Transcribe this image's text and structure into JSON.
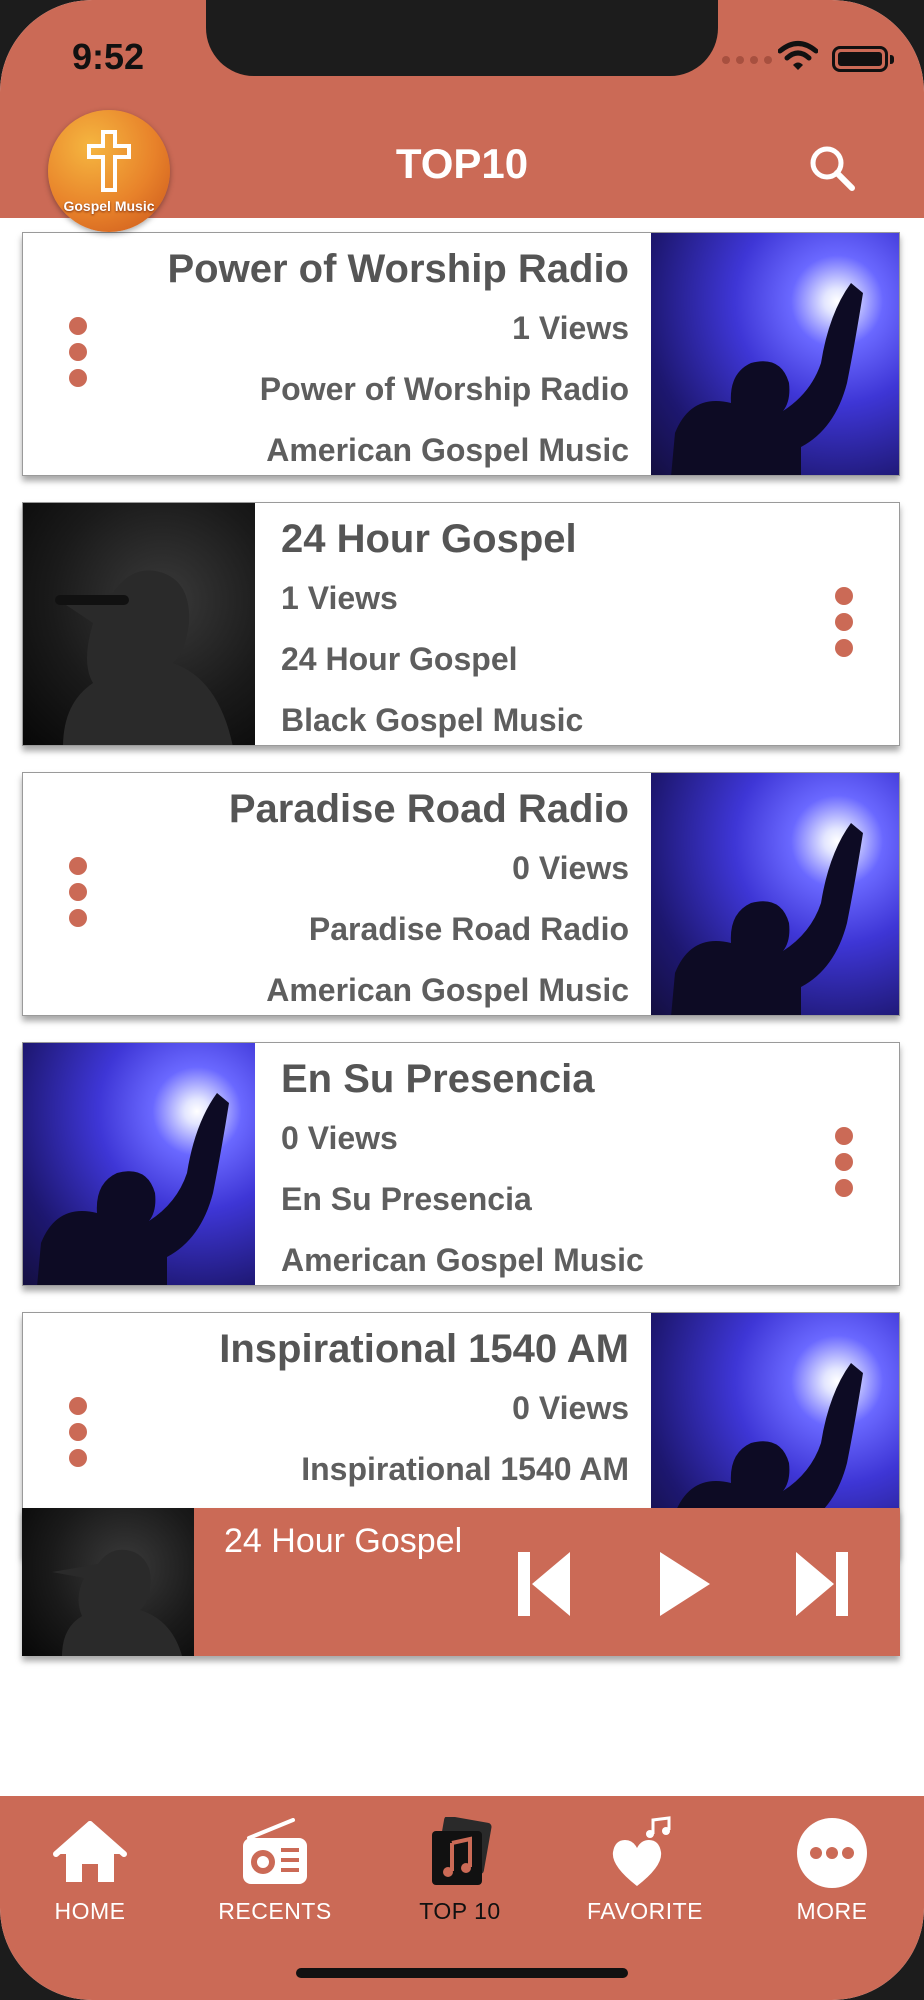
{
  "status_bar": {
    "time": "9:52"
  },
  "header": {
    "logo_text": "Gospel Music",
    "title": "TOP10"
  },
  "stations": [
    {
      "name": "Power of Worship Radio",
      "views": "1 Views",
      "subtitle": "Power of Worship Radio",
      "genre": "American Gospel Music"
    },
    {
      "name": " 24 Hour Gospel",
      "views": "1 Views",
      "subtitle": " 24 Hour Gospel",
      "genre": "Black Gospel Music"
    },
    {
      "name": "Paradise Road Radio",
      "views": "0 Views",
      "subtitle": "Paradise Road Radio",
      "genre": "American Gospel Music"
    },
    {
      "name": "En Su Presencia",
      "views": "0 Views",
      "subtitle": "En Su Presencia",
      "genre": "American Gospel Music"
    },
    {
      "name": "Inspirational 1540 AM",
      "views": "0 Views",
      "subtitle": "Inspirational 1540 AM",
      "genre": ""
    }
  ],
  "player": {
    "title": "24 Hour Gospel"
  },
  "tabs": [
    {
      "label": "HOME",
      "icon": "home-icon"
    },
    {
      "label": "RECENTS",
      "icon": "radio-icon"
    },
    {
      "label": "TOP 10",
      "icon": "music-album-icon"
    },
    {
      "label": "FAVORITE",
      "icon": "heart-icon"
    },
    {
      "label": "MORE",
      "icon": "more-icon"
    }
  ],
  "colors": {
    "brand": "#cb6a56",
    "text": "#5e5e5e"
  }
}
